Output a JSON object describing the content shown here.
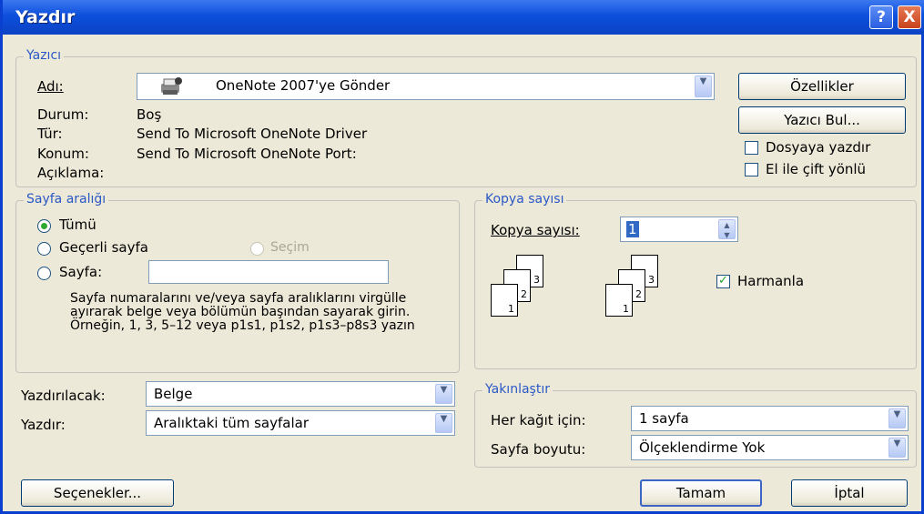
{
  "window": {
    "title": "Yazdır",
    "help_glyph": "?",
    "close_glyph": "X"
  },
  "printer": {
    "group_label": "Yazıcı",
    "name_label": "Adı:",
    "name_value": "OneNote 2007'ye Gönder",
    "status_label": "Durum:",
    "status_value": "Boş",
    "type_label": "Tür:",
    "type_value": "Send To Microsoft OneNote Driver",
    "location_label": "Konum:",
    "location_value": "Send To Microsoft OneNote Port:",
    "comment_label": "Açıklama:",
    "comment_value": "",
    "properties_button": "Özellikler",
    "find_printer_button": "Yazıcı Bul...",
    "print_to_file_label": "Dosyaya yazdır",
    "print_to_file_checked": false,
    "manual_duplex_label": "El ile çift yönlü",
    "manual_duplex_checked": false
  },
  "page_range": {
    "group_label": "Sayfa aralığı",
    "all_label": "Tümü",
    "current_label": "Geçerli sayfa",
    "selection_label": "Seçim",
    "pages_label": "Sayfa:",
    "pages_value": "",
    "selected": "all",
    "help_text": "Sayfa numaralarını ve/veya sayfa aralıklarını virgülle ayırarak belge veya bölümün başından sayarak girin. Örneğin, 1, 3, 5–12 veya p1s1, p1s2, p1s3–p8s3 yazın"
  },
  "copies": {
    "group_label": "Kopya sayısı",
    "count_label": "Kopya sayısı:",
    "count_value": "1",
    "collate_label": "Harmanla",
    "collate_checked": true,
    "page_numbers": [
      "1",
      "2",
      "3"
    ]
  },
  "print_what": {
    "label": "Yazdırılacak:",
    "value": "Belge"
  },
  "print": {
    "label": "Yazdır:",
    "value": "Aralıktaki tüm sayfalar"
  },
  "zoom": {
    "group_label": "Yakınlaştır",
    "pages_per_sheet_label": "Her kağıt için:",
    "pages_per_sheet_value": "1 sayfa",
    "scale_label": "Sayfa boyutu:",
    "scale_value": "Ölçeklendirme Yok"
  },
  "buttons": {
    "options": "Seçenekler...",
    "ok": "Tamam",
    "cancel": "İptal"
  },
  "icons": {
    "combo_arrow": "chevron-down-icon",
    "spinner": "spinner-icon",
    "printer": "printer-icon"
  }
}
